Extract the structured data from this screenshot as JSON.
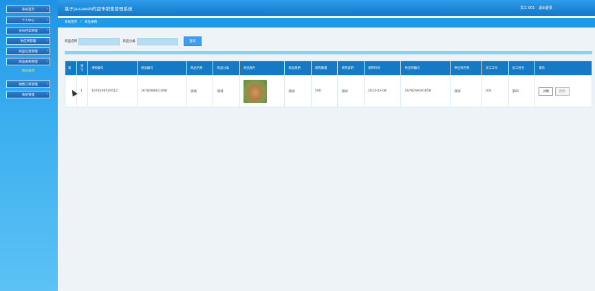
{
  "sidebar": {
    "items": [
      {
        "label": "系统首页"
      },
      {
        "label": "个人中心"
      },
      {
        "label": "会员档案管理"
      },
      {
        "label": "供应商管理"
      },
      {
        "label": "商品信息管理"
      },
      {
        "label": "商品采购管理"
      },
      {
        "label": "销售订单管理"
      },
      {
        "label": "系统管理"
      }
    ],
    "active_sub": "商品采购"
  },
  "header": {
    "title": "基于javaweb的超市销售管理系统",
    "user": "员工 001",
    "logout": "退出登录"
  },
  "breadcrumb": {
    "home": "系统首页",
    "sep": "/",
    "current": "商品采购"
  },
  "search": {
    "name_label": "商品名称",
    "category_label": "商品分类",
    "button": "查询"
  },
  "table": {
    "headers": [
      "索",
      "采购编号",
      "商品编号",
      "商品名称",
      "商品分类",
      "商品图片",
      "商品规格",
      "采购数量",
      "采购说明",
      "采购时间",
      "供应商编号",
      "供应商名称",
      "员工工号",
      "员工姓名",
      "操作"
    ],
    "rows": [
      {
        "index": "1",
        "cells": [
          "1678269529512",
          "1678269411698",
          "测试",
          "测试",
          "",
          "测试",
          "500",
          "测试",
          "2023-03-08",
          "1678269391658",
          "测试",
          "001",
          "李四"
        ],
        "detail": "详情",
        "edit": "修改"
      }
    ]
  }
}
